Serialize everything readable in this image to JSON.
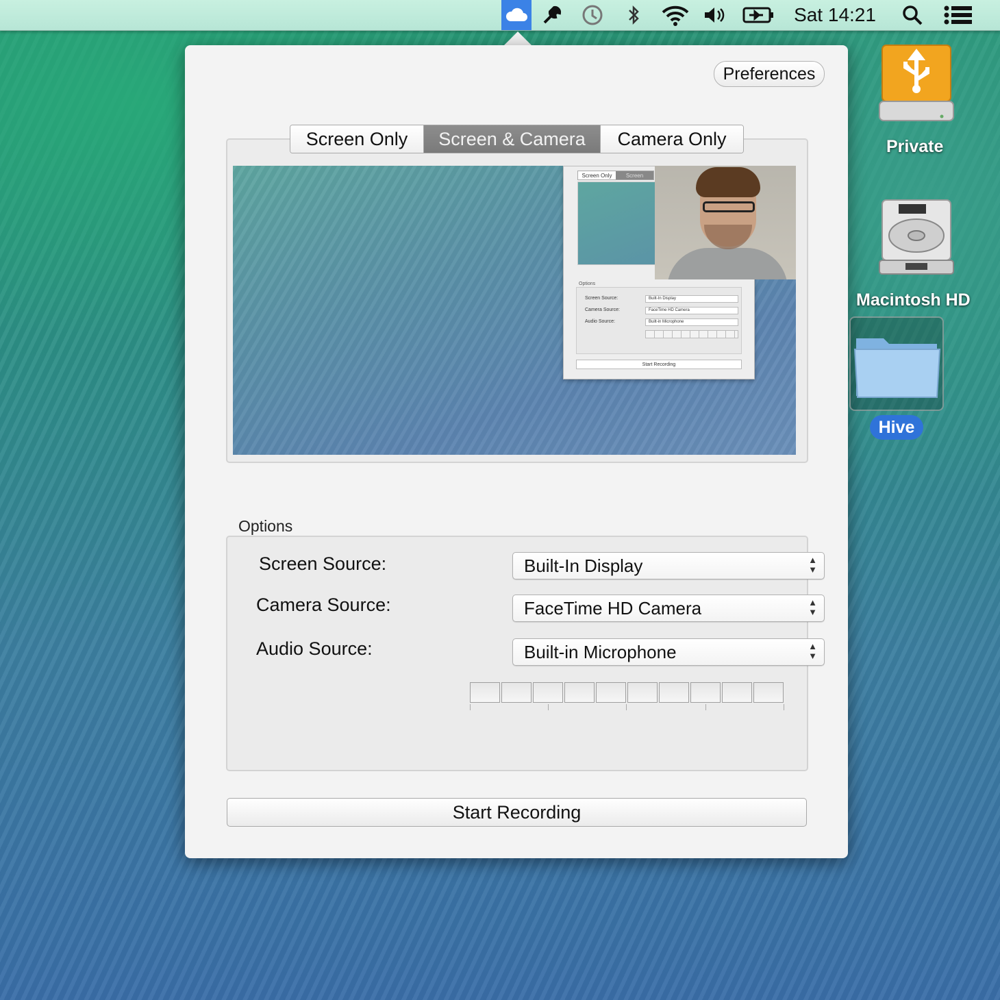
{
  "menubar": {
    "clock": "Sat 14:21",
    "icons": [
      "cloud-icon",
      "wrench-icon",
      "time-machine-icon",
      "bluetooth-icon",
      "wifi-icon",
      "volume-icon",
      "battery-icon",
      "spotlight-icon",
      "notification-center-icon"
    ]
  },
  "popover": {
    "preferences_label": "Preferences",
    "tabs": [
      {
        "label": "Screen Only",
        "selected": false
      },
      {
        "label": "Screen & Camera",
        "selected": true
      },
      {
        "label": "Camera Only",
        "selected": false
      }
    ],
    "preview": {
      "mini": {
        "tab1": "Screen Only",
        "tab2": "Screen",
        "options": "Options",
        "rows": [
          {
            "label": "Screen Source:",
            "value": "Built-In Display"
          },
          {
            "label": "Camera Source:",
            "value": "FaceTime HD Camera"
          },
          {
            "label": "Audio Source:",
            "value": "Built-in Microphone"
          }
        ],
        "start": "Start Recording"
      }
    },
    "options_label": "Options",
    "screen_source_label": "Screen Source:",
    "screen_source_value": "Built-In Display",
    "camera_source_label": "Camera Source:",
    "camera_source_value": "FaceTime HD Camera",
    "audio_source_label": "Audio Source:",
    "audio_source_value": "Built-in Microphone",
    "audio_level": 0,
    "start_label": "Start Recording"
  },
  "desktop": {
    "items": [
      {
        "label": "Private",
        "icon": "usb-drive-icon"
      },
      {
        "label": "Macintosh HD",
        "icon": "hard-drive-icon"
      },
      {
        "label": "Hive",
        "icon": "folder-icon",
        "selected": true
      }
    ]
  },
  "colors": {
    "menubar_active": "#3b82e6",
    "selection_blue": "#2f73d9",
    "usb_orange": "#f0a020"
  }
}
